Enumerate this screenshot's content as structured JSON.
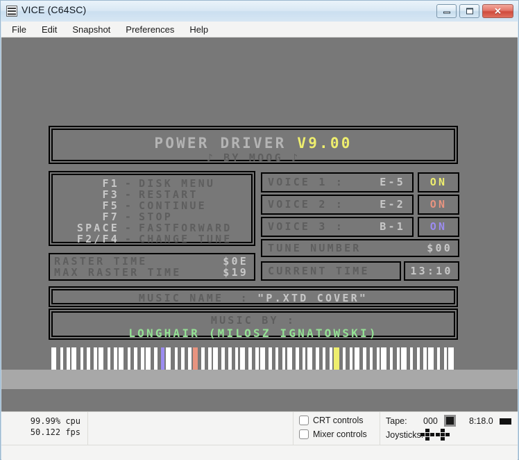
{
  "window": {
    "title": "VICE (C64SC)",
    "icon": "c64-icon",
    "buttons": {
      "minimize": "minimize-icon",
      "maximize": "maximize-icon",
      "close": "✕"
    }
  },
  "menubar": {
    "items": [
      {
        "label": "File"
      },
      {
        "label": "Edit"
      },
      {
        "label": "Snapshot"
      },
      {
        "label": "Preferences"
      },
      {
        "label": "Help"
      }
    ]
  },
  "screen": {
    "title_panel": {
      "name": "POWER DRIVER",
      "version": "V9.00",
      "subtitle": "♪ BY MOOG ♪"
    },
    "keys": [
      {
        "key": "F1",
        "dash": "-",
        "action": "DISK MENU"
      },
      {
        "key": "F3",
        "dash": "-",
        "action": "RESTART"
      },
      {
        "key": "F5",
        "dash": "-",
        "action": "CONTINUE"
      },
      {
        "key": "F7",
        "dash": "-",
        "action": "STOP"
      },
      {
        "key": "SPACE",
        "dash": "-",
        "action": "FASTFORWARD"
      },
      {
        "key": "F2/F4",
        "dash": "-",
        "action": "CHANGE TUNE"
      }
    ],
    "voices": [
      {
        "label": "VOICE 1 :",
        "note": "E-5",
        "state": "ON",
        "color": "#eeee6e"
      },
      {
        "label": "VOICE 2 :",
        "note": "E-2",
        "state": "ON",
        "color": "#e89480"
      },
      {
        "label": "VOICE 3 :",
        "note": "B-1",
        "state": "ON",
        "color": "#9c8cf0"
      }
    ],
    "tune": {
      "label": "TUNE NUMBER",
      "value": "$00"
    },
    "raster": [
      {
        "label": "RASTER TIME",
        "value": "$0E"
      },
      {
        "label": "MAX RASTER TIME",
        "value": "$19"
      }
    ],
    "current_time": {
      "label": "CURRENT TIME",
      "value": "13:10"
    },
    "music_name": {
      "label": "MUSIC NAME  :",
      "value": "\"P.XTD COVER\""
    },
    "music_by": {
      "label": "MUSIC BY :",
      "value": "LONGHAIR (MILOSZ IGNATOWSKI)"
    },
    "piano": {
      "white_key_count": 60,
      "highlighted": [
        {
          "index": 16,
          "color": "#9c8cf0",
          "note": "B-1"
        },
        {
          "index": 21,
          "color": "#e89480",
          "note": "E-2"
        },
        {
          "index": 42,
          "color": "#eeee6e",
          "note": "E-5"
        }
      ]
    },
    "colors": {
      "background": "#787878",
      "bright_text": "#c8c8c8",
      "dim_text": "#5e5e5e",
      "green": "#94e294",
      "yellow": "#eeee6e"
    }
  },
  "statusbar": {
    "cpu": "99.99% cpu",
    "fps": "50.122 fps",
    "crt_controls": {
      "label": "CRT controls",
      "checked": false
    },
    "mixer_controls": {
      "label": "Mixer controls",
      "checked": false
    },
    "tape": {
      "label": "Tape:",
      "counter": "000"
    },
    "drive": {
      "label": "8:18.0"
    },
    "joysticks": {
      "label": "Joysticks:",
      "count": 2
    }
  }
}
